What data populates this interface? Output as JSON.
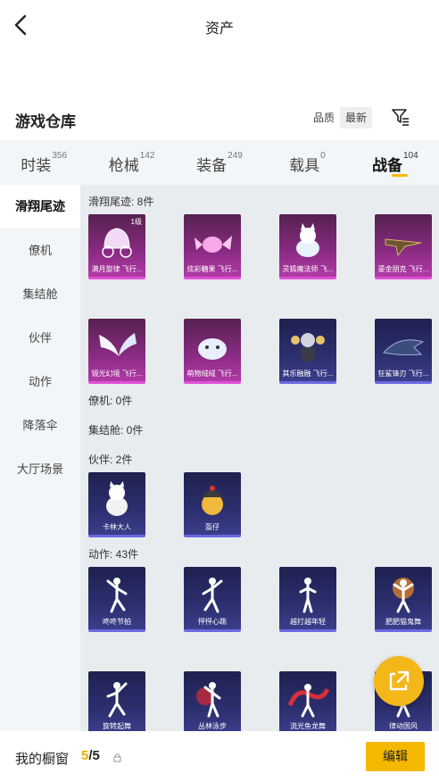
{
  "header": {
    "title": "资产"
  },
  "warehouse": {
    "title": "游戏仓库",
    "sort_quality": "品质",
    "sort_latest": "最新"
  },
  "tabs": [
    {
      "label": "时装",
      "count": "356"
    },
    {
      "label": "枪械",
      "count": "142"
    },
    {
      "label": "装备",
      "count": "249"
    },
    {
      "label": "载具",
      "count": "0"
    },
    {
      "label": "战备",
      "count": "104"
    }
  ],
  "sidebar": {
    "items": [
      "滑翔尾迹",
      "僚机",
      "集结舱",
      "伙伴",
      "动作",
      "降落伞",
      "大厅场景"
    ]
  },
  "sections": {
    "glide": {
      "title": "滑翔尾迹: 8件",
      "items": [
        {
          "name": "满月旋律 飞行...",
          "level": "1级"
        },
        {
          "name": "炫彩糖果 飞行..."
        },
        {
          "name": "灵狐魔法师 飞..."
        },
        {
          "name": "鎏金朋克 飞行..."
        },
        {
          "name": "镜光幻境 飞行..."
        },
        {
          "name": "萌物绒绒 飞行..."
        },
        {
          "name": "其乐融融 飞行..."
        },
        {
          "name": "狂鲨锋刃 飞行..."
        }
      ]
    },
    "wingman": {
      "title": "僚机: 0件"
    },
    "pod": {
      "title": "集结舱: 0件"
    },
    "partner": {
      "title": "伙伴: 2件",
      "items": [
        {
          "name": "卡林大人"
        },
        {
          "name": "盔仔"
        }
      ]
    },
    "emote": {
      "title": "动作: 43件",
      "items": [
        {
          "name": "咚咚节拍"
        },
        {
          "name": "怦怦心跳"
        },
        {
          "name": "越打越年轻"
        },
        {
          "name": "肥肥猫鬼舞"
        },
        {
          "name": "旋转起舞"
        },
        {
          "name": "丛林泳步"
        },
        {
          "name": "流光鱼龙舞"
        },
        {
          "name": "律动国风"
        }
      ]
    }
  },
  "bottom": {
    "label": "我的橱窗",
    "current": "5",
    "separator": "/",
    "total": "5",
    "edit": "编辑"
  },
  "colors": {
    "accent": "#f5b800",
    "rare_pink": "#e050d6",
    "rare_purple": "#6b68e2"
  },
  "icons": [
    "back-arrow-icon",
    "filter-icon",
    "lock-icon",
    "share-icon"
  ]
}
